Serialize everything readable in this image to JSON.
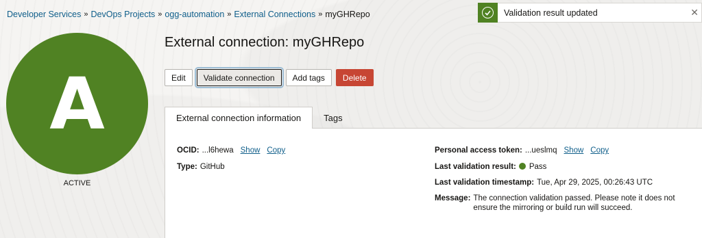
{
  "breadcrumb": {
    "items": [
      "Developer Services",
      "DevOps Projects",
      "ogg-automation",
      "External Connections"
    ],
    "current": "myGHRepo",
    "separator": "»"
  },
  "toast": {
    "message": "Validation result updated",
    "close_glyph": "✕",
    "icon": "check-circle-icon"
  },
  "avatar": {
    "letter": "A",
    "state": "ACTIVE",
    "color": "#508223"
  },
  "page": {
    "title": "External connection: myGHRepo"
  },
  "actions": {
    "edit": "Edit",
    "validate": "Validate connection",
    "add_tags": "Add tags",
    "delete": "Delete"
  },
  "tabs": {
    "info": "External connection information",
    "tags": "Tags"
  },
  "details": {
    "ocid_label": "OCID:",
    "ocid_value": "...l6hewa",
    "show": "Show",
    "copy": "Copy",
    "type_label": "Type:",
    "type_value": "GitHub",
    "token_label": "Personal access token:",
    "token_value": "...ueslmq",
    "last_result_label": "Last validation result:",
    "last_result_value": "Pass",
    "last_ts_label": "Last validation timestamp:",
    "last_ts_value": "Tue, Apr 29, 2025, 00:26:43 UTC",
    "message_label": "Message:",
    "message_value": "The connection validation passed. Please note it does not ensure the mirroring or build run will succeed."
  }
}
